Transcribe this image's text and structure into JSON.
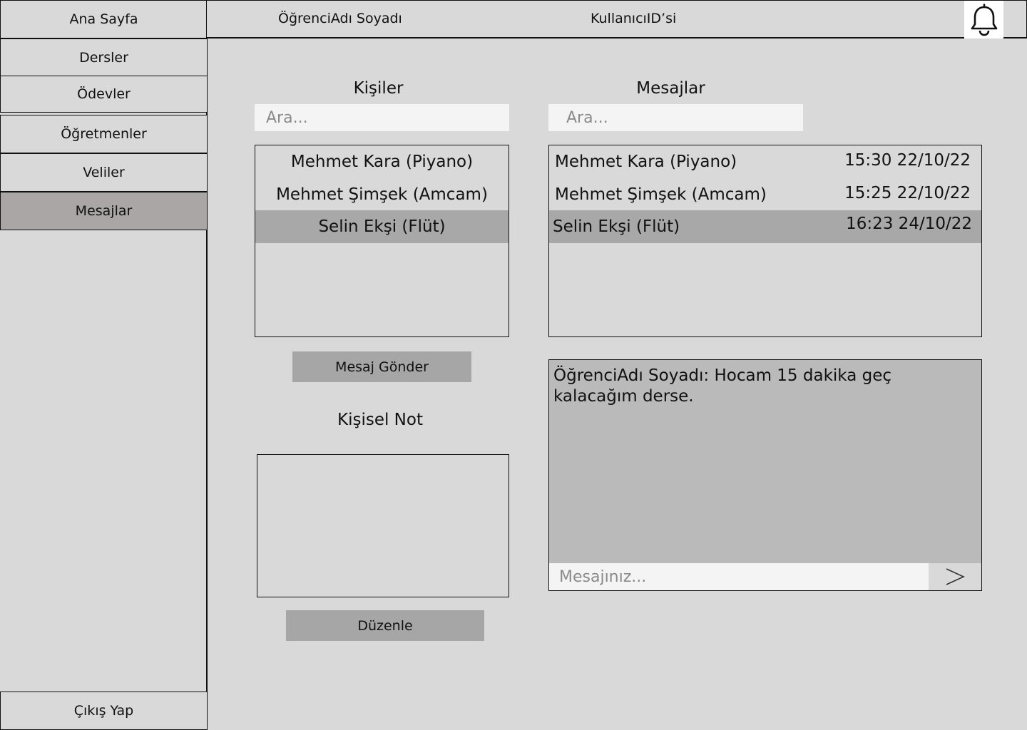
{
  "header": {
    "home_label": "Ana Sayfa",
    "student_name": "ÖğrenciAdı Soyadı",
    "user_id": "KullanıcıID’si",
    "bell_icon": "bell-icon"
  },
  "sidebar": {
    "items": [
      {
        "label": "Dersler"
      },
      {
        "label": "Ödevler"
      },
      {
        "label": "Öğretmenler"
      },
      {
        "label": "Veliler"
      },
      {
        "label": "Mesajlar",
        "active": true
      }
    ],
    "logout_label": "Çıkış Yap"
  },
  "contacts": {
    "title": "Kişiler",
    "search_placeholder": "Ara...",
    "items": [
      {
        "name": "Mehmet Kara (Piyano)"
      },
      {
        "name": "Mehmet Şimşek (Amcam)"
      },
      {
        "name": "Selin Ekşi (Flüt)",
        "selected": true
      }
    ],
    "send_button_label": "Mesaj Gönder"
  },
  "note": {
    "title": "Kişisel Not",
    "edit_button_label": "Düzenle"
  },
  "messages": {
    "title": "Mesajlar",
    "search_placeholder": "Ara...",
    "items": [
      {
        "sender": "Mehmet Kara (Piyano)",
        "time": "15:30 22/10/22"
      },
      {
        "sender": "Mehmet Şimşek  (Amcam)",
        "time": "15:25 22/10/22"
      },
      {
        "sender": "Selin Ekşi (Flüt)",
        "time": "16:23 24/10/22",
        "selected": true
      }
    ]
  },
  "conversation": {
    "message_text": "ÖğrenciAdı Soyadı: Hocam 15 dakika geç kalacağım derse.",
    "compose_placeholder": "Mesajınız...",
    "send_icon": "send-arrow-icon"
  },
  "colors": {
    "background": "#d9d9d9",
    "active_nav": "#aaa6a6",
    "selected_row": "#a8a8a8",
    "button": "#a6a6a6",
    "input_bg": "#f5f4f5",
    "conversation_bg": "#bababa"
  }
}
